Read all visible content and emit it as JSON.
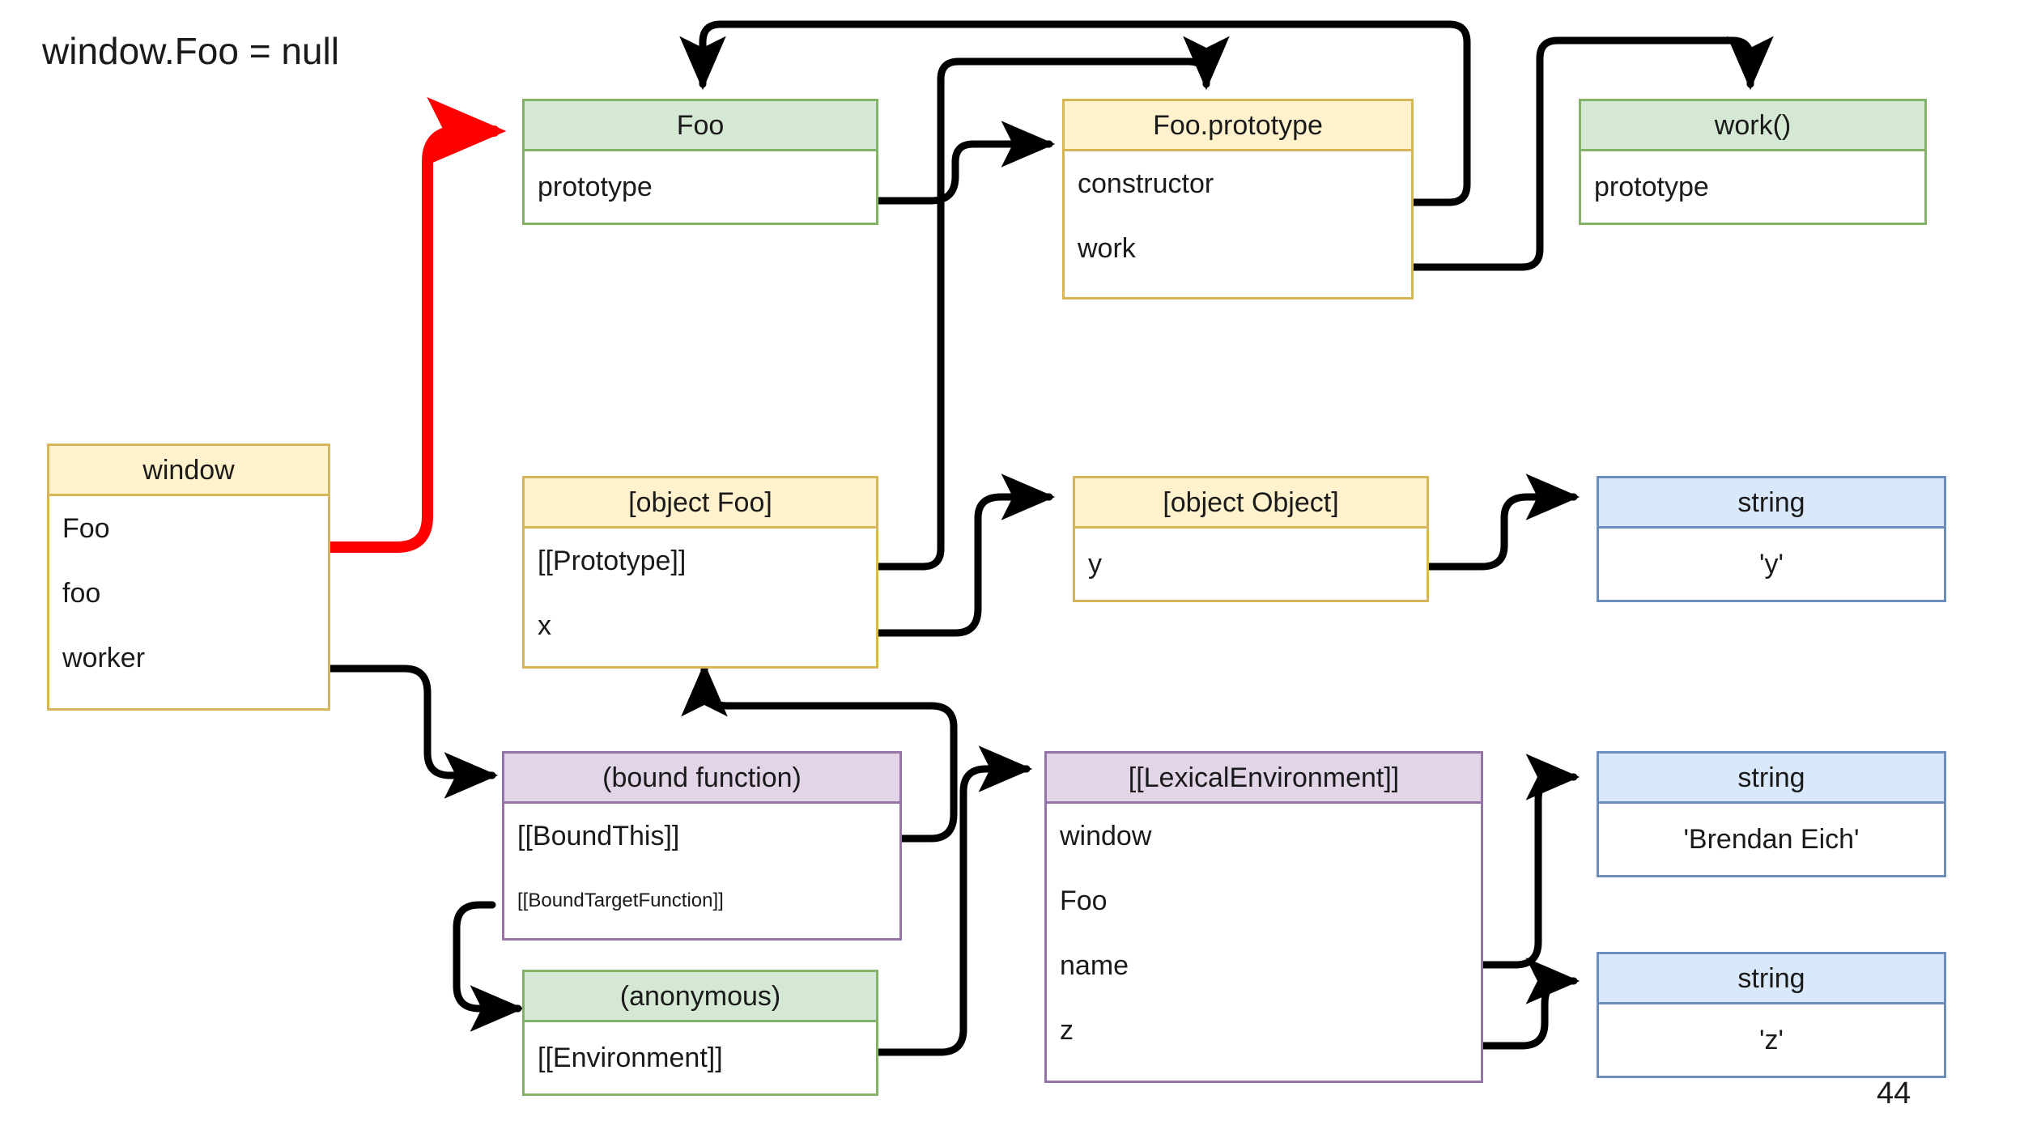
{
  "caption": "window.Foo = null",
  "page_number": "44",
  "colors": {
    "green_fill": "#d5e8d4",
    "green_stroke": "#82b366",
    "yellow_fill": "#fff2cc",
    "yellow_stroke": "#d6b656",
    "blue_fill": "#dae8fc",
    "blue_stroke": "#6c8ebf",
    "purple_fill": "#e1d5e7",
    "purple_stroke": "#9673a6",
    "edge": "#000000",
    "highlight_edge": "#ff0000"
  },
  "nodes": {
    "foo": {
      "title": "Foo",
      "fields": [
        "prototype"
      ]
    },
    "foo_prototype": {
      "title": "Foo.prototype",
      "fields": [
        "constructor",
        "work"
      ]
    },
    "work": {
      "title": "work()",
      "fields": [
        "prototype"
      ]
    },
    "window": {
      "title": "window",
      "fields": [
        "Foo",
        "foo",
        "worker"
      ]
    },
    "object_foo": {
      "title": "[object Foo]",
      "fields": [
        "[[Prototype]]",
        "x"
      ]
    },
    "object_object": {
      "title": "[object Object]",
      "fields": [
        "y"
      ]
    },
    "string_y": {
      "title": "string",
      "fields": [
        "'y'"
      ]
    },
    "bound_function": {
      "title": "(bound function)",
      "fields": [
        "[[BoundThis]]",
        "[[BoundTargetFunction]]"
      ]
    },
    "lexical_environment": {
      "title": "[[LexicalEnvironment]]",
      "fields": [
        "window",
        "Foo",
        "name",
        "z"
      ]
    },
    "string_brendan": {
      "title": "string",
      "fields": [
        "'Brendan Eich'"
      ]
    },
    "anonymous": {
      "title": "(anonymous)",
      "fields": [
        "[[Environment]]"
      ]
    },
    "string_z": {
      "title": "string",
      "fields": [
        "'z'"
      ]
    }
  },
  "edges": [
    {
      "name": "window-Foo-to-Foo",
      "from": "window.Foo",
      "to": "foo",
      "color": "#ff0000"
    },
    {
      "name": "Foo-prototype-to-Foo.prototype",
      "from": "foo.prototype",
      "to": "foo_prototype",
      "color": "#000000"
    },
    {
      "name": "Foo.prototype-constructor-to-Foo",
      "from": "foo_prototype.constructor",
      "to": "foo",
      "color": "#000000"
    },
    {
      "name": "Foo.prototype-work-to-work",
      "from": "foo_prototype.work",
      "to": "work",
      "color": "#000000"
    },
    {
      "name": "objectFoo-prototype-to-Foo.prototype",
      "from": "object_foo.[[Prototype]]",
      "to": "foo_prototype",
      "color": "#000000"
    },
    {
      "name": "objectFoo-x-to-objectObject",
      "from": "object_foo.x",
      "to": "object_object",
      "color": "#000000"
    },
    {
      "name": "objectObject-y-to-string-y",
      "from": "object_object.y",
      "to": "string_y",
      "color": "#000000"
    },
    {
      "name": "window-worker-to-bound-function",
      "from": "window.worker",
      "to": "bound_function",
      "color": "#000000"
    },
    {
      "name": "boundThis-to-objectFoo",
      "from": "bound_function.[[BoundThis]]",
      "to": "object_foo",
      "color": "#000000"
    },
    {
      "name": "boundTargetFunction-to-anonymous",
      "from": "bound_function.[[BoundTargetFunction]]",
      "to": "anonymous",
      "color": "#000000"
    },
    {
      "name": "anonymous-environment-to-lexical-environment",
      "from": "anonymous.[[Environment]]",
      "to": "lexical_environment",
      "color": "#000000"
    },
    {
      "name": "lexenv-name-to-string-brendan",
      "from": "lexical_environment.name",
      "to": "string_brendan",
      "color": "#000000"
    },
    {
      "name": "lexenv-z-to-string-z",
      "from": "lexical_environment.z",
      "to": "string_z",
      "color": "#000000"
    }
  ]
}
